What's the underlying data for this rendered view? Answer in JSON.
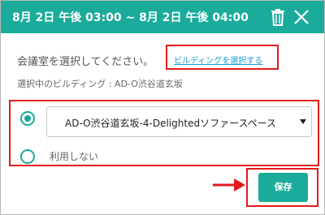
{
  "dialog": {
    "title": "8月 2日 午後 03:00 ~ 8月 2日 午後 04:00",
    "header_color": "#1aab9b",
    "icons": {
      "delete": "trash-icon",
      "close": "close-icon"
    }
  },
  "room": {
    "prompt": "会議室を選択してください。",
    "select_building_link": "ビルディングを選択する",
    "current_building": "選択中のビルディング : AD-O渋谷道玄坂",
    "options": [
      {
        "type": "room-select",
        "selected": true,
        "value": "AD-O渋谷道玄坂-4-Delightedソファースペース"
      },
      {
        "type": "no-use",
        "selected": false,
        "label": "利用しない"
      }
    ]
  },
  "footer": {
    "save_label": "保存",
    "annotation_color": "#e31a1c"
  }
}
